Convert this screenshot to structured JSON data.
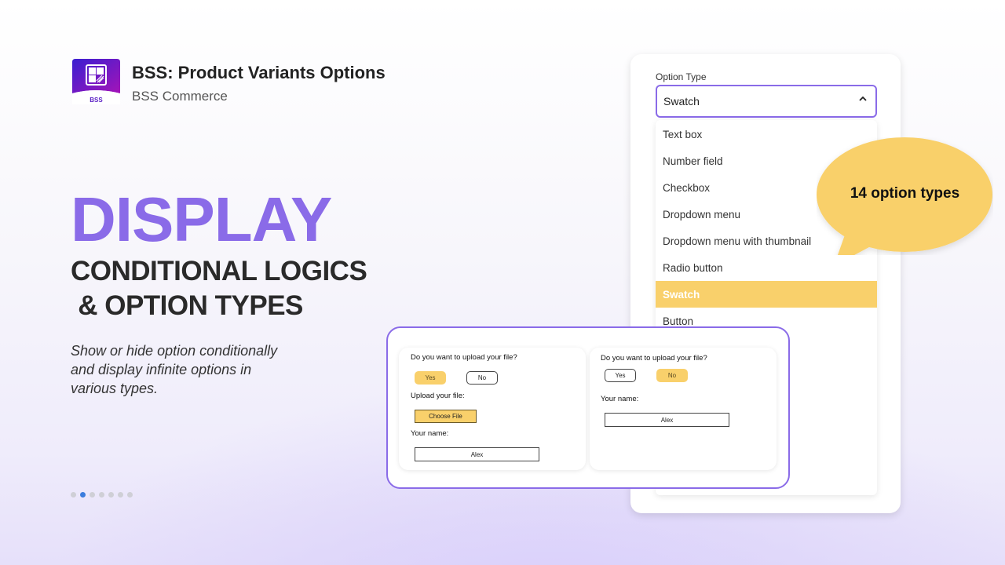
{
  "app": {
    "title": "BSS: Product Variants Options",
    "vendor": "BSS Commerce",
    "logo_text": "BSS",
    "logo_colors": [
      "#3a1fd1",
      "#a414b8"
    ]
  },
  "hero": {
    "headline": "DISPLAY",
    "subline_1": "CONDITIONAL LOGICS",
    "subline_2": " & OPTION TYPES",
    "description": "Show or hide option conditionally and display infinite options in various types.",
    "accent_color": "#8a6be8"
  },
  "pagination": {
    "total": 7,
    "active_index": 1
  },
  "option_panel": {
    "label": "Option Type",
    "selected_value": "Swatch",
    "chevron_icon": "chevron-up-icon",
    "options": [
      {
        "label": "Text box",
        "selected": false
      },
      {
        "label": "Number field",
        "selected": false
      },
      {
        "label": "Checkbox",
        "selected": false
      },
      {
        "label": "Dropdown menu",
        "selected": false
      },
      {
        "label": "Dropdown menu with thumbnail",
        "selected": false
      },
      {
        "label": "Radio button",
        "selected": false
      },
      {
        "label": "Swatch",
        "selected": true
      },
      {
        "label": "Button",
        "selected": false
      }
    ],
    "highlight_color": "#f9d06b"
  },
  "bubble": {
    "text": "14 option types",
    "color": "#f9d06b"
  },
  "demo": {
    "card_a": {
      "question": "Do you want to upload your file?",
      "yes_label": "Yes",
      "no_label": "No",
      "selected": "Yes",
      "upload_label": "Upload your file:",
      "choose_file_label": "Choose File",
      "name_label": "Your name:",
      "name_value": "Alex"
    },
    "card_b": {
      "question": "Do you want to upload your file?",
      "yes_label": "Yes",
      "no_label": "No",
      "selected": "No",
      "name_label": "Your name:",
      "name_value": "Alex"
    }
  }
}
